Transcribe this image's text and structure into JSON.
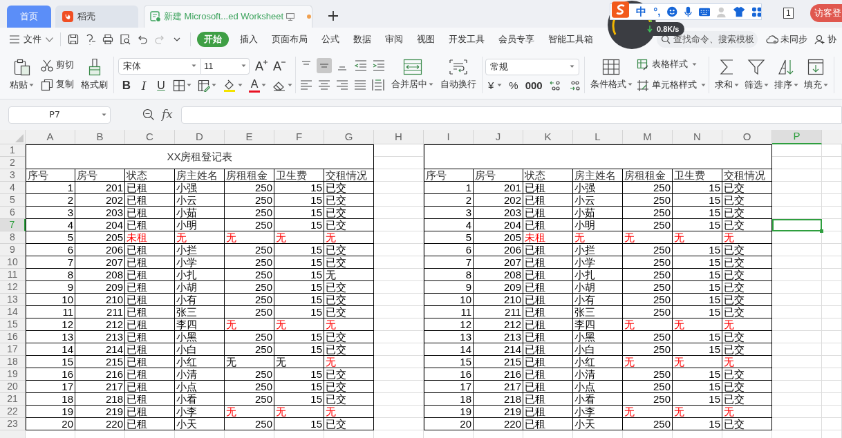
{
  "tabs": [
    {
      "kind": "home",
      "label": "首页",
      "selected": false
    },
    {
      "kind": "app",
      "label": "稻壳",
      "selected": false
    },
    {
      "kind": "document",
      "label": "新建 Microsoft...ed Worksheet",
      "selected": true,
      "modified": true
    }
  ],
  "window_count": "1",
  "login": "访客登",
  "ime": {
    "mode": "中",
    "punctuation": "°,",
    "speed": "0.8K/s"
  },
  "menu": {
    "file": "文件",
    "ribbon_tabs": [
      {
        "label": "开始",
        "selected": true
      },
      {
        "label": "插入",
        "selected": false
      },
      {
        "label": "页面布局",
        "selected": false
      },
      {
        "label": "公式",
        "selected": false
      },
      {
        "label": "数据",
        "selected": false
      },
      {
        "label": "审阅",
        "selected": false
      },
      {
        "label": "视图",
        "selected": false
      },
      {
        "label": "开发工具",
        "selected": false
      },
      {
        "label": "会员专享",
        "selected": false
      },
      {
        "label": "智能工具箱",
        "selected": false
      }
    ],
    "search_placeholder": "查找命令、搜索模板",
    "sync": "未同步",
    "collab": "协"
  },
  "ribbon": {
    "paste": "粘贴",
    "cut": "剪切",
    "copy": "复制",
    "painter": "格式刷",
    "font_family": "宋体",
    "font_size": "11",
    "font_size_buttons": [
      {
        "kind": "grow",
        "label": "A"
      },
      {
        "kind": "shrink",
        "label": "A"
      }
    ],
    "font_style_buttons": [
      {
        "kind": "bold",
        "label": "B"
      },
      {
        "kind": "italic",
        "label": "I"
      },
      {
        "kind": "underline",
        "label": "U"
      }
    ],
    "font_color_label": "A",
    "vertical_align": [
      {
        "kind": "top",
        "selected": false
      },
      {
        "kind": "middle",
        "selected": true
      },
      {
        "kind": "bottom",
        "selected": false
      }
    ],
    "merge": "合并居中",
    "wrap": "自动换行",
    "number_format": "常规",
    "number_buttons": [
      {
        "kind": "currency",
        "label": "¥"
      },
      {
        "kind": "percent",
        "label": "%"
      },
      {
        "kind": "thousands",
        "label": "000"
      }
    ],
    "conditional_format": "条件格式",
    "table_style": "表格样式",
    "cell_style": "单元格样式",
    "editing": [
      {
        "kind": "sum",
        "label": "求和"
      },
      {
        "kind": "filter",
        "label": "筛选"
      },
      {
        "kind": "sort",
        "label": "排序"
      },
      {
        "kind": "fill",
        "label": "填充"
      }
    ]
  },
  "formula_bar": {
    "name_box": "P7",
    "fx_label": "fx"
  },
  "columns": [
    {
      "label": "A",
      "selected": false
    },
    {
      "label": "B",
      "selected": false
    },
    {
      "label": "C",
      "selected": false
    },
    {
      "label": "D",
      "selected": false
    },
    {
      "label": "E",
      "selected": false
    },
    {
      "label": "F",
      "selected": false
    },
    {
      "label": "G",
      "selected": false
    },
    {
      "label": "H",
      "selected": false
    },
    {
      "label": "I",
      "selected": false
    },
    {
      "label": "J",
      "selected": false
    },
    {
      "label": "K",
      "selected": false
    },
    {
      "label": "L",
      "selected": false
    },
    {
      "label": "M",
      "selected": false
    },
    {
      "label": "N",
      "selected": false
    },
    {
      "label": "O",
      "selected": false
    },
    {
      "label": "P",
      "selected": true
    }
  ],
  "rows": [
    {
      "label": "1",
      "selected": false
    },
    {
      "label": "2",
      "selected": false
    },
    {
      "label": "3",
      "selected": false
    },
    {
      "label": "4",
      "selected": false
    },
    {
      "label": "5",
      "selected": false
    },
    {
      "label": "6",
      "selected": false
    },
    {
      "label": "7",
      "selected": true
    },
    {
      "label": "8",
      "selected": false
    },
    {
      "label": "9",
      "selected": false
    },
    {
      "label": "10",
      "selected": false
    },
    {
      "label": "11",
      "selected": false
    },
    {
      "label": "12",
      "selected": false
    },
    {
      "label": "13",
      "selected": false
    },
    {
      "label": "14",
      "selected": false
    },
    {
      "label": "15",
      "selected": false
    },
    {
      "label": "16",
      "selected": false
    },
    {
      "label": "17",
      "selected": false
    },
    {
      "label": "18",
      "selected": false
    },
    {
      "label": "19",
      "selected": false
    },
    {
      "label": "20",
      "selected": false
    },
    {
      "label": "21",
      "selected": false
    },
    {
      "label": "22",
      "selected": false
    },
    {
      "label": "23",
      "selected": false
    }
  ],
  "tables": [
    {
      "title": "XX房租登记表",
      "headers": [
        "序号",
        "房号",
        "状态",
        "房主姓名",
        "房租租金",
        "卫生费",
        "交租情况"
      ],
      "records": [
        {
          "cells": [
            "1",
            "201",
            "已租",
            "小强",
            "250",
            "15",
            "已交"
          ],
          "alert": [
            false,
            false,
            false,
            false,
            false,
            false,
            false
          ]
        },
        {
          "cells": [
            "2",
            "202",
            "已租",
            "小云",
            "250",
            "15",
            "已交"
          ],
          "alert": [
            false,
            false,
            false,
            false,
            false,
            false,
            false
          ]
        },
        {
          "cells": [
            "3",
            "203",
            "已租",
            "小茹",
            "250",
            "15",
            "已交"
          ],
          "alert": [
            false,
            false,
            false,
            false,
            false,
            false,
            false
          ]
        },
        {
          "cells": [
            "4",
            "204",
            "已租",
            "小明",
            "250",
            "15",
            "已交"
          ],
          "alert": [
            false,
            false,
            false,
            false,
            false,
            false,
            false
          ]
        },
        {
          "cells": [
            "5",
            "205",
            "未租",
            "无",
            "无",
            "无",
            "无"
          ],
          "alert": [
            false,
            false,
            true,
            true,
            true,
            true,
            true
          ]
        },
        {
          "cells": [
            "6",
            "206",
            "已租",
            "小拦",
            "250",
            "15",
            "已交"
          ],
          "alert": [
            false,
            false,
            false,
            false,
            false,
            false,
            false
          ]
        },
        {
          "cells": [
            "7",
            "207",
            "已租",
            "小学",
            "250",
            "15",
            "已交"
          ],
          "alert": [
            false,
            false,
            false,
            false,
            false,
            false,
            false
          ]
        },
        {
          "cells": [
            "8",
            "208",
            "已租",
            "小扎",
            "250",
            "15",
            "无"
          ],
          "alert": [
            false,
            false,
            false,
            false,
            false,
            false,
            false
          ]
        },
        {
          "cells": [
            "9",
            "209",
            "已租",
            "小胡",
            "250",
            "15",
            "已交"
          ],
          "alert": [
            false,
            false,
            false,
            false,
            false,
            false,
            false
          ]
        },
        {
          "cells": [
            "10",
            "210",
            "已租",
            "小有",
            "250",
            "15",
            "已交"
          ],
          "alert": [
            false,
            false,
            false,
            false,
            false,
            false,
            false
          ]
        },
        {
          "cells": [
            "11",
            "211",
            "已租",
            "张三",
            "250",
            "15",
            "已交"
          ],
          "alert": [
            false,
            false,
            false,
            false,
            false,
            false,
            false
          ]
        },
        {
          "cells": [
            "12",
            "212",
            "已租",
            "李四",
            "无",
            "无",
            "无"
          ],
          "alert": [
            false,
            false,
            false,
            false,
            true,
            true,
            true
          ]
        },
        {
          "cells": [
            "13",
            "213",
            "已租",
            "小黑",
            "250",
            "15",
            "已交"
          ],
          "alert": [
            false,
            false,
            false,
            false,
            false,
            false,
            false
          ]
        },
        {
          "cells": [
            "14",
            "214",
            "已租",
            "小白",
            "250",
            "15",
            "已交"
          ],
          "alert": [
            false,
            false,
            false,
            false,
            false,
            false,
            false
          ]
        },
        {
          "cells": [
            "15",
            "215",
            "已租",
            "小红",
            "无",
            "无",
            "无"
          ],
          "alert": [
            false,
            false,
            false,
            false,
            false,
            false,
            true
          ]
        },
        {
          "cells": [
            "16",
            "216",
            "已租",
            "小清",
            "250",
            "15",
            "已交"
          ],
          "alert": [
            false,
            false,
            false,
            false,
            false,
            false,
            false
          ]
        },
        {
          "cells": [
            "17",
            "217",
            "已租",
            "小点",
            "250",
            "15",
            "已交"
          ],
          "alert": [
            false,
            false,
            false,
            false,
            false,
            false,
            false
          ]
        },
        {
          "cells": [
            "18",
            "218",
            "已租",
            "小看",
            "250",
            "15",
            "已交"
          ],
          "alert": [
            false,
            false,
            false,
            false,
            false,
            false,
            false
          ]
        },
        {
          "cells": [
            "19",
            "219",
            "已租",
            "小李",
            "无",
            "无",
            "无"
          ],
          "alert": [
            false,
            false,
            false,
            false,
            true,
            true,
            true
          ]
        },
        {
          "cells": [
            "20",
            "220",
            "已租",
            "小天",
            "250",
            "15",
            "已交"
          ],
          "alert": [
            false,
            false,
            false,
            false,
            false,
            false,
            false
          ]
        }
      ]
    },
    {
      "headers": [
        "序号",
        "房号",
        "状态",
        "房主姓名",
        "房租租金",
        "卫生费",
        "交租情况"
      ],
      "records": [
        {
          "cells": [
            "1",
            "201",
            "已租",
            "小强",
            "250",
            "15",
            "已交"
          ],
          "alert": [
            false,
            false,
            false,
            false,
            false,
            false,
            false
          ]
        },
        {
          "cells": [
            "2",
            "202",
            "已租",
            "小云",
            "250",
            "15",
            "已交"
          ],
          "alert": [
            false,
            false,
            false,
            false,
            false,
            false,
            false
          ]
        },
        {
          "cells": [
            "3",
            "203",
            "已租",
            "小茹",
            "250",
            "15",
            "已交"
          ],
          "alert": [
            false,
            false,
            false,
            false,
            false,
            false,
            false
          ]
        },
        {
          "cells": [
            "4",
            "204",
            "已租",
            "小明",
            "250",
            "15",
            "已交"
          ],
          "alert": [
            false,
            false,
            false,
            false,
            false,
            false,
            false
          ]
        },
        {
          "cells": [
            "5",
            "205",
            "未租",
            "无",
            "无",
            "无",
            "无"
          ],
          "alert": [
            false,
            false,
            true,
            true,
            true,
            true,
            true
          ]
        },
        {
          "cells": [
            "6",
            "206",
            "已租",
            "小拦",
            "250",
            "15",
            "已交"
          ],
          "alert": [
            false,
            false,
            false,
            false,
            false,
            false,
            false
          ]
        },
        {
          "cells": [
            "7",
            "207",
            "已租",
            "小学",
            "250",
            "15",
            "已交"
          ],
          "alert": [
            false,
            false,
            false,
            false,
            false,
            false,
            false
          ]
        },
        {
          "cells": [
            "8",
            "208",
            "已租",
            "小扎",
            "250",
            "15",
            "已交"
          ],
          "alert": [
            false,
            false,
            false,
            false,
            false,
            false,
            false
          ]
        },
        {
          "cells": [
            "9",
            "209",
            "已租",
            "小胡",
            "250",
            "15",
            "已交"
          ],
          "alert": [
            false,
            false,
            false,
            false,
            false,
            false,
            false
          ]
        },
        {
          "cells": [
            "10",
            "210",
            "已租",
            "小有",
            "250",
            "15",
            "已交"
          ],
          "alert": [
            false,
            false,
            false,
            false,
            false,
            false,
            false
          ]
        },
        {
          "cells": [
            "11",
            "211",
            "已租",
            "张三",
            "250",
            "15",
            "已交"
          ],
          "alert": [
            false,
            false,
            false,
            false,
            false,
            false,
            false
          ]
        },
        {
          "cells": [
            "12",
            "212",
            "已租",
            "李四",
            "无",
            "无",
            "无"
          ],
          "alert": [
            false,
            false,
            false,
            false,
            true,
            true,
            true
          ]
        },
        {
          "cells": [
            "13",
            "213",
            "已租",
            "小黑",
            "250",
            "15",
            "已交"
          ],
          "alert": [
            false,
            false,
            false,
            false,
            false,
            false,
            false
          ]
        },
        {
          "cells": [
            "14",
            "214",
            "已租",
            "小白",
            "250",
            "15",
            "已交"
          ],
          "alert": [
            false,
            false,
            false,
            false,
            false,
            false,
            false
          ]
        },
        {
          "cells": [
            "15",
            "215",
            "已租",
            "小红",
            "无",
            "无",
            "无"
          ],
          "alert": [
            false,
            false,
            false,
            false,
            true,
            true,
            true
          ]
        },
        {
          "cells": [
            "16",
            "216",
            "已租",
            "小清",
            "250",
            "15",
            "已交"
          ],
          "alert": [
            false,
            false,
            false,
            false,
            false,
            false,
            false
          ]
        },
        {
          "cells": [
            "17",
            "217",
            "已租",
            "小点",
            "250",
            "15",
            "已交"
          ],
          "alert": [
            false,
            false,
            false,
            false,
            false,
            false,
            false
          ]
        },
        {
          "cells": [
            "18",
            "218",
            "已租",
            "小看",
            "250",
            "15",
            "已交"
          ],
          "alert": [
            false,
            false,
            false,
            false,
            false,
            false,
            false
          ]
        },
        {
          "cells": [
            "19",
            "219",
            "已租",
            "小李",
            "无",
            "无",
            "无"
          ],
          "alert": [
            false,
            false,
            false,
            false,
            true,
            true,
            true
          ]
        },
        {
          "cells": [
            "20",
            "220",
            "已租",
            "小天",
            "250",
            "15",
            "已交"
          ],
          "alert": [
            false,
            false,
            false,
            false,
            false,
            false,
            false
          ]
        }
      ]
    }
  ]
}
